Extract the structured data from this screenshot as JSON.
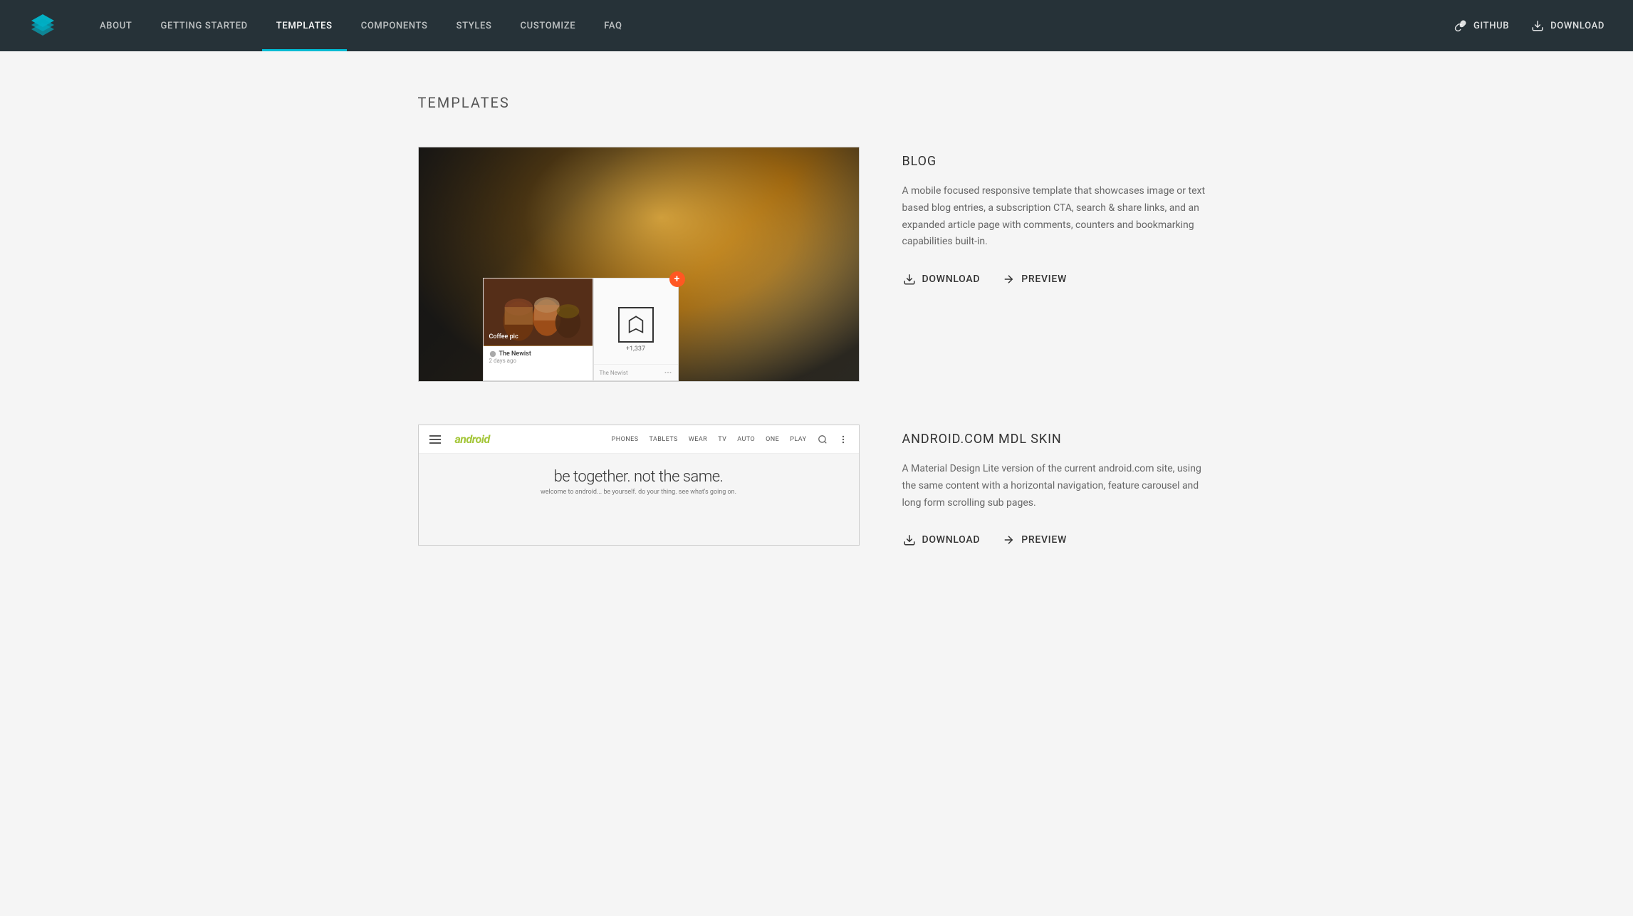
{
  "navbar": {
    "logo_alt": "MDL Logo",
    "nav_items": [
      {
        "id": "about",
        "label": "ABOUT",
        "active": false
      },
      {
        "id": "getting-started",
        "label": "GETTING STARTED",
        "active": false
      },
      {
        "id": "templates",
        "label": "TEMPLATES",
        "active": true
      },
      {
        "id": "components",
        "label": "COMPONENTS",
        "active": false
      },
      {
        "id": "styles",
        "label": "STYLES",
        "active": false
      },
      {
        "id": "customize",
        "label": "CUSTOMIZE",
        "active": false
      },
      {
        "id": "faq",
        "label": "FAQ",
        "active": false
      }
    ],
    "github_label": "GitHub",
    "download_label": "Download"
  },
  "page": {
    "title": "TEMPLATES"
  },
  "templates": [
    {
      "id": "blog",
      "name": "BLOG",
      "description": "A mobile focused responsive template that showcases image or text based blog entries, a subscription CTA, search & share links, and an expanded article page with comments, counters and bookmarking capabilities built-in.",
      "download_label": "Download",
      "preview_label": "Preview",
      "preview": {
        "type": "blog",
        "card_left_title": "The Newist",
        "card_left_date": "2 days ago",
        "card_right_title": "The Newist",
        "card_right_count": "+1,337",
        "coffee_label": "Coffee pic",
        "orange_plus": "+"
      }
    },
    {
      "id": "android",
      "name": "ANDROID.COM MDL SKIN",
      "description": "A Material Design Lite version of the current android.com site, using the same content with a horizontal navigation, feature carousel and long form scrolling sub pages.",
      "download_label": "Download",
      "preview_label": "Preview",
      "preview": {
        "type": "android",
        "logo": "android",
        "nav_links": [
          "PHONES",
          "TABLETS",
          "WEAR",
          "TV",
          "AUTO",
          "ONE",
          "PLAY"
        ],
        "hero_title": "be together. not the same.",
        "hero_subtitle": "welcome to android... be yourself. do your thing. see what's going on."
      }
    }
  ]
}
